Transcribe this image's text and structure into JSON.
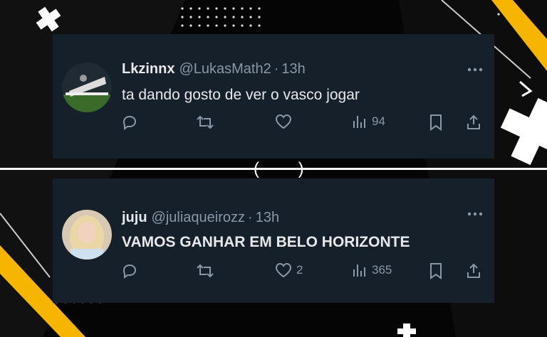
{
  "colors": {
    "card": "#15202b",
    "text": "#e7e9ea",
    "muted": "#8b98a5",
    "accent": "#f7b500"
  },
  "separator": {
    "text": "( )"
  },
  "tweets": [
    {
      "name": "Lkzinnx",
      "handle": "@LukasMath2",
      "dot": "·",
      "time": "13h",
      "text": "ta dando gosto de ver o vasco jogar",
      "likes": "",
      "views": "94",
      "icons": [
        "reply-icon",
        "retweet-icon",
        "heart-icon",
        "views-icon",
        "bookmark-icon",
        "share-icon",
        "more-icon"
      ]
    },
    {
      "name": "juju",
      "handle": "@juliaqueirozz",
      "dot": "·",
      "time": "13h",
      "text": "VAMOS GANHAR EM BELO HORIZONTE",
      "likes": "2",
      "views": "365",
      "icons": [
        "reply-icon",
        "retweet-icon",
        "heart-icon",
        "views-icon",
        "bookmark-icon",
        "share-icon",
        "more-icon"
      ]
    }
  ]
}
